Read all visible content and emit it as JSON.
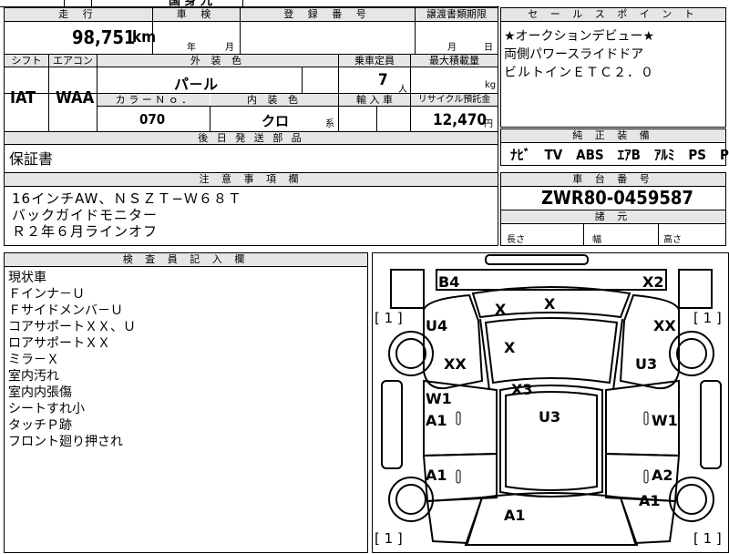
{
  "top_strip": {
    "partial_text": "国 身 九"
  },
  "vehicle_info": {
    "mileage_header": "走 行",
    "mileage_value": "98,751",
    "mileage_unit": "km",
    "inspection_header": "車 検",
    "inspection_year_unit": "年",
    "inspection_month_unit": "月",
    "registration_header": "登 録 番 号",
    "transfer_deadline_header": "譲渡書類期限",
    "transfer_month_unit": "月",
    "transfer_day_unit": "日",
    "shift_header": "シフト",
    "shift_value": "IAT",
    "aircon_header": "エアコン",
    "aircon_value": "WAA",
    "exterior_color_header": "外 装 色",
    "exterior_color_value": "パ－ル",
    "capacity_header": "乗車定員",
    "capacity_value": "7",
    "capacity_unit": "人",
    "max_load_header": "最大積載量",
    "max_load_unit": "kg",
    "color_no_header": "カ ラ ー Ｎ ｏ ．",
    "color_no_value": "070",
    "interior_color_header": "内 装 色",
    "interior_color_value": "クロ",
    "interior_color_unit": "系",
    "import_header": "輸 入 車",
    "recycle_header": "リサイクル預託金",
    "recycle_value": "12,470",
    "recycle_unit": "円",
    "later_parts_header": "後 日 発 送 部 品",
    "later_parts_value": "保証書"
  },
  "sales_points": {
    "header": "セ ー ル ス ポ イ ン ト",
    "lines": [
      "★オークションデビュー★",
      "両側パワースライドドア",
      "ビルトインＥＴＣ２．０"
    ]
  },
  "standard_equipment": {
    "header": "純 正 装 備",
    "items": "ﾅﾋﾞ　TV　ABS　ｴｱB　ｱﾙﾐ　PS　PW"
  },
  "notes": {
    "header": "注 意 事 項 欄",
    "lines": [
      "16インチAW、ＮＳＺＴ−Ｗ６８Ｔ",
      "バックガイドモニター",
      "Ｒ２年６月ラインオフ"
    ]
  },
  "chassis": {
    "header": "車 台 番 号",
    "value": "ZWR80-0459587",
    "dims_header": "諸 元",
    "length_label": "長さ",
    "width_label": "幅",
    "height_label": "高さ"
  },
  "inspector": {
    "header": "検 査 員 記 入 欄",
    "lines": [
      "現状車",
      "Ｆインナ－Ｕ",
      "Ｆサイドメンバ－Ｕ",
      "コアサポートＸＸ、Ｕ",
      "ロアサポートＸＸ",
      "ミラ－Ｘ",
      "室内汚れ",
      "室内内張傷",
      "シートすれ小",
      "タッチＰ跡",
      "フロント廻り押され"
    ]
  },
  "diagram": {
    "tire_marks": {
      "front_left": "[ 1 ]",
      "front_right": "[ 1 ]",
      "rear_left": "[ 1 ]",
      "rear_right": "[ 1 ]"
    },
    "codes": {
      "front_bumper_left": "B4",
      "front_bumper_right": "X2",
      "hood_left": "X",
      "hood_center": "X",
      "front_fender_left": "U4",
      "front_fender_right": "XX",
      "windshield": "X",
      "front_wheel_left": "XX",
      "front_wheel_right": "U3",
      "roof_front": "X3",
      "roof": "U3",
      "left_front_door_upper": "W1",
      "left_front_door_lower": "A1",
      "right_front_door": "W1",
      "left_rear_door": "A1",
      "right_rear_door": "A2",
      "right_rear_quarter": "A1",
      "rear": "A1"
    }
  }
}
